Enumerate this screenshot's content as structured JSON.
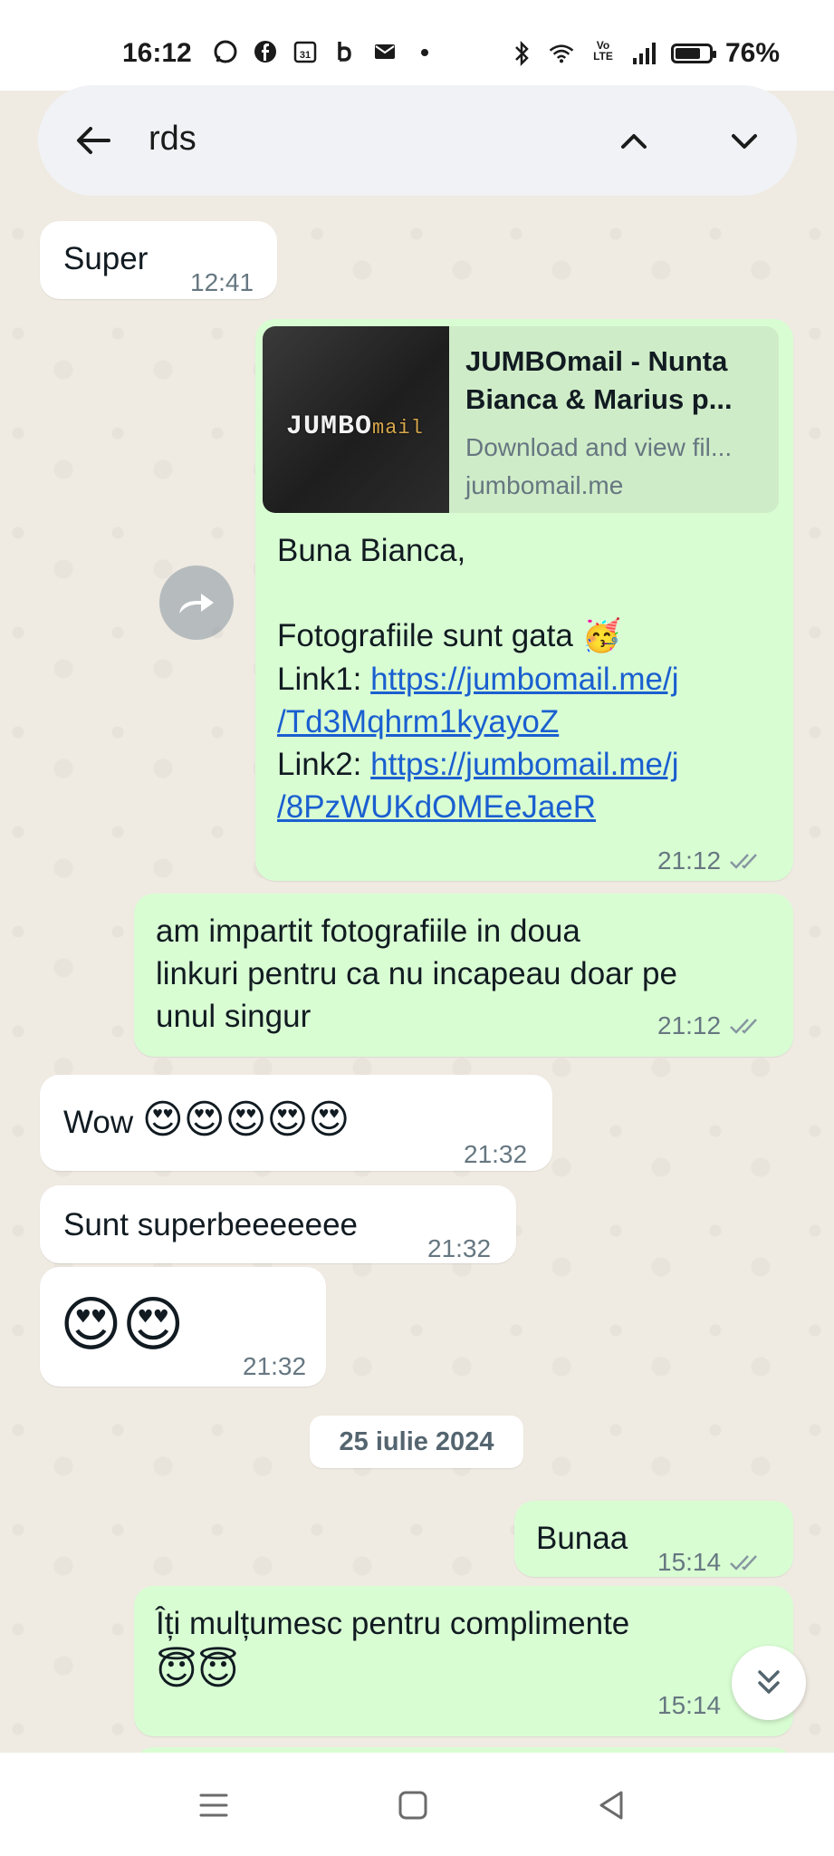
{
  "status_bar": {
    "time": "16:12",
    "battery": "76%",
    "battery_level": 0.76,
    "network_label": "Vo LTE"
  },
  "search": {
    "query": "rds"
  },
  "messages": {
    "m1": {
      "text": "Super",
      "time": "12:41"
    },
    "m2": {
      "preview_title": "JUMBOmail - Nunta Bianca & Marius p...",
      "preview_desc": "Download and view fil...",
      "preview_domain": "jumbomail.me",
      "thumb_logo": "JUMBO",
      "thumb_logo_suffix": "mail",
      "greeting": "Buna Bianca,",
      "line2": "Fotografiile sunt gata",
      "line2_emoji": "🥳",
      "link1_label": "Link1: ",
      "link1_a": "https://jumbomail.me/j",
      "link1_b": "/Td3Mqhrm1kyayoZ",
      "link2_label": "Link2: ",
      "link2_a": "https://jumbomail.me/j",
      "link2_b": "/8PzWUKdOMEeJaeR",
      "time": "21:12"
    },
    "m3": {
      "line1": "am impartit fotografiile in doua",
      "line2": "linkuri pentru ca nu incapeau doar pe",
      "line3": "unul singur",
      "time": "21:12"
    },
    "m4": {
      "text": "Wow",
      "emojis": "😍😍😍😍😍",
      "time": "21:32"
    },
    "m5": {
      "text": "Sunt superbeeeeeee",
      "time": "21:32"
    },
    "m6": {
      "emojis": "😍😍",
      "time": "21:32"
    },
    "date_divider": "25 iulie 2024",
    "m7": {
      "text": "Bunaa",
      "time": "15:14"
    },
    "m8": {
      "line1": "Îți mulțumesc pentru complimente",
      "emojis": "😇😇",
      "time": "15:14"
    }
  },
  "colors": {
    "outgoing_bubble": "#d9fdd3",
    "incoming_bubble": "#ffffff",
    "link": "#1a5fd0",
    "chat_background": "#efeae2"
  }
}
